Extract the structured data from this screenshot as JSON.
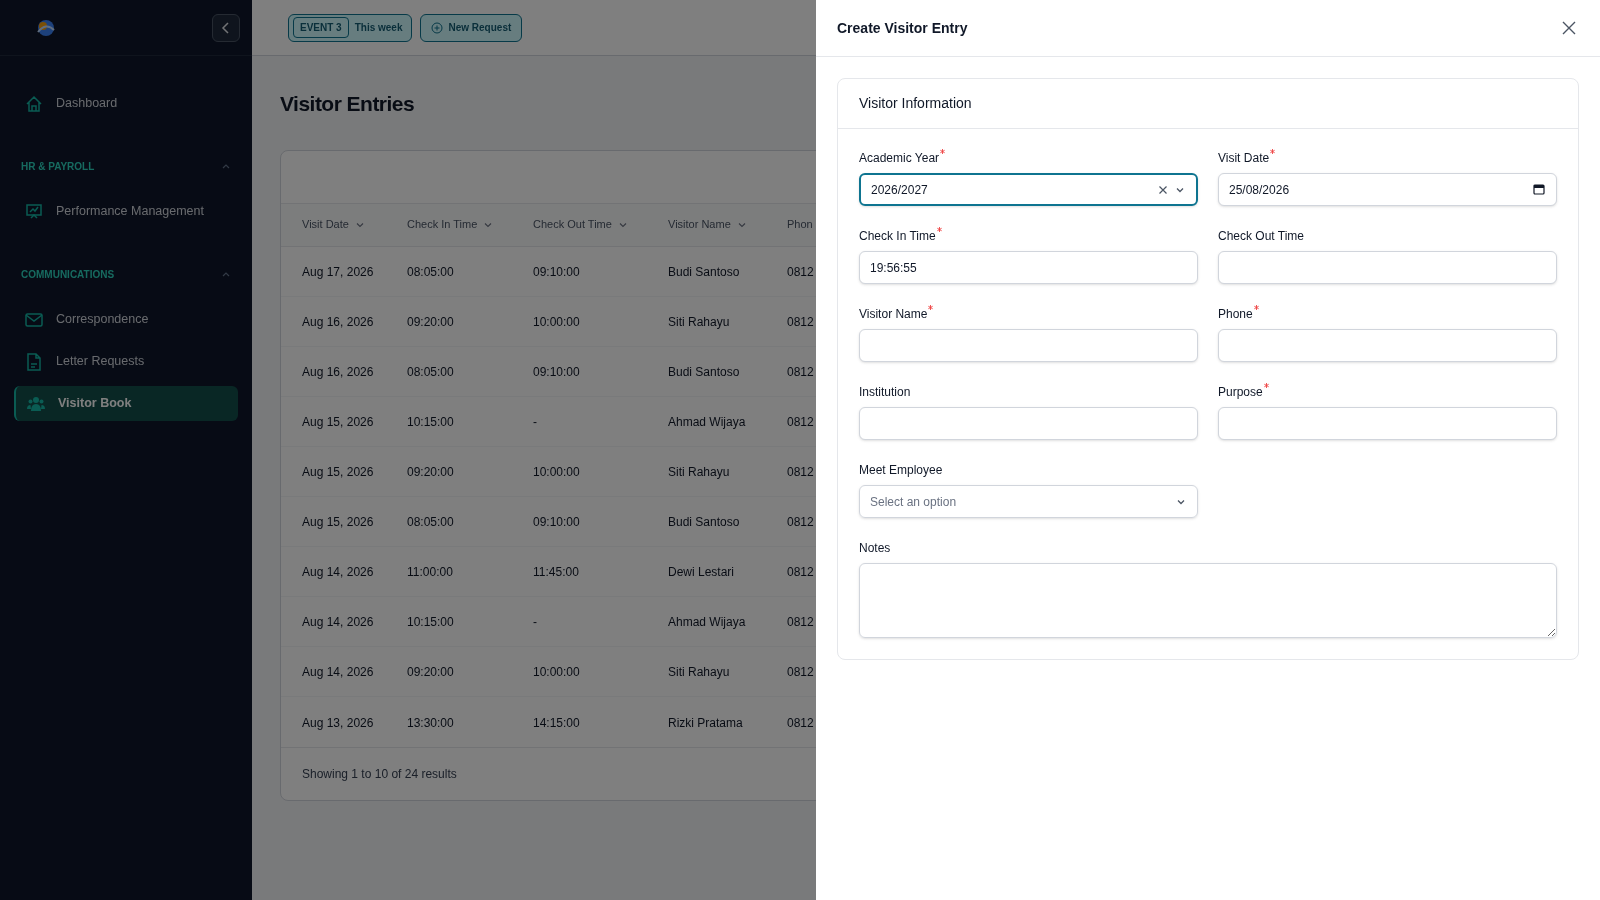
{
  "sidebar": {
    "sections": [
      {
        "items": [
          {
            "label": "Dashboard",
            "selected": false
          }
        ]
      },
      {
        "heading": "HR & PAYROLL",
        "expanded": true,
        "items": [
          {
            "label": "Performance Management",
            "selected": false
          }
        ]
      },
      {
        "heading": "COMMUNICATIONS",
        "expanded": true,
        "items": [
          {
            "label": "Correspondence",
            "selected": false
          },
          {
            "label": "Letter Requests",
            "selected": false
          },
          {
            "label": "Visitor Book",
            "selected": true
          }
        ]
      }
    ]
  },
  "topbar": {
    "event_badge": "EVENT 3",
    "event_label": "This week",
    "new_request": "New Request"
  },
  "page_title": "Visitor Entries",
  "table": {
    "columns": [
      "Visit Date",
      "Check In Time",
      "Check Out Time",
      "Visitor Name",
      "Phon"
    ],
    "rows": [
      [
        "Aug 17, 2026",
        "08:05:00",
        "09:10:00",
        "Budi Santoso",
        "0812"
      ],
      [
        "Aug 16, 2026",
        "09:20:00",
        "10:00:00",
        "Siti Rahayu",
        "0812"
      ],
      [
        "Aug 16, 2026",
        "08:05:00",
        "09:10:00",
        "Budi Santoso",
        "0812"
      ],
      [
        "Aug 15, 2026",
        "10:15:00",
        "-",
        "Ahmad Wijaya",
        "0812"
      ],
      [
        "Aug 15, 2026",
        "09:20:00",
        "10:00:00",
        "Siti Rahayu",
        "0812"
      ],
      [
        "Aug 15, 2026",
        "08:05:00",
        "09:10:00",
        "Budi Santoso",
        "0812"
      ],
      [
        "Aug 14, 2026",
        "11:00:00",
        "11:45:00",
        "Dewi Lestari",
        "0812"
      ],
      [
        "Aug 14, 2026",
        "10:15:00",
        "-",
        "Ahmad Wijaya",
        "0812"
      ],
      [
        "Aug 14, 2026",
        "09:20:00",
        "10:00:00",
        "Siti Rahayu",
        "0812"
      ],
      [
        "Aug 13, 2026",
        "13:30:00",
        "14:15:00",
        "Rizki Pratama",
        "0812"
      ]
    ],
    "footer": "Showing 1 to 10 of 24 results"
  },
  "drawer": {
    "title": "Create Visitor Entry",
    "section_title": "Visitor Information",
    "fields": [
      {
        "label": "Academic Year",
        "required": true,
        "kind": "select",
        "value": "2026/2027",
        "focused": true,
        "clearable": true
      },
      {
        "label": "Visit Date",
        "required": true,
        "kind": "date",
        "value": "25/08/2026",
        "focused": false
      },
      {
        "label": "Check In Time",
        "required": true,
        "kind": "text",
        "value": "19:56:55",
        "focused": false
      },
      {
        "label": "Check Out Time",
        "required": false,
        "kind": "text",
        "focused": false
      },
      {
        "label": "Visitor Name",
        "required": true,
        "kind": "text",
        "focused": false
      },
      {
        "label": "Phone",
        "required": true,
        "kind": "text",
        "focused": false
      },
      {
        "label": "Institution",
        "required": false,
        "kind": "text",
        "focused": false
      },
      {
        "label": "Purpose",
        "required": true,
        "kind": "text",
        "focused": false
      },
      {
        "label": "Meet Employee",
        "required": false,
        "kind": "select",
        "placeholder": "Select an option",
        "focused": false
      },
      {
        "label": "Notes",
        "required": false,
        "kind": "textarea",
        "focused": false
      }
    ]
  }
}
